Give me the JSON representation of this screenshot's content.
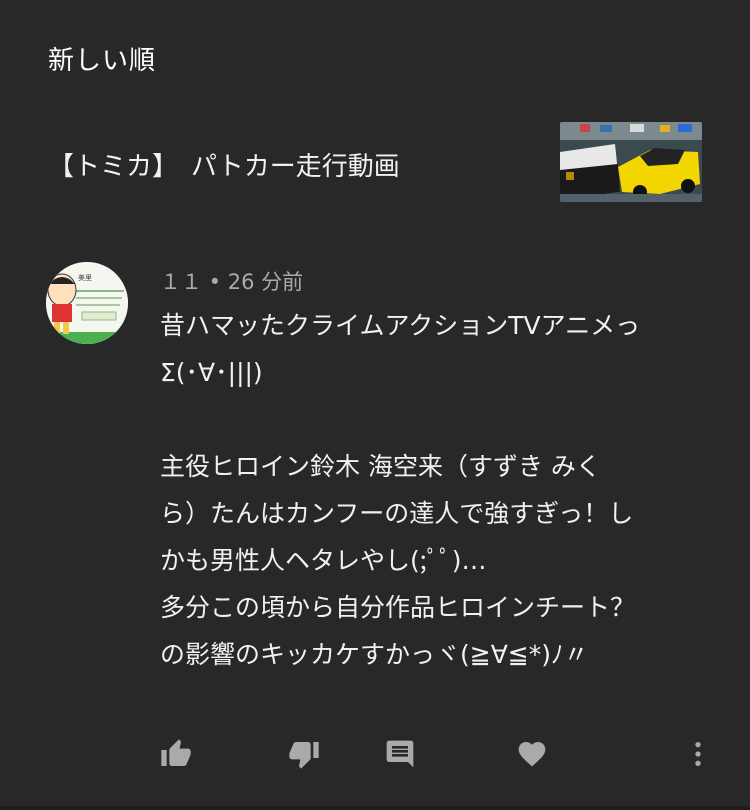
{
  "header": {
    "sort_label": "新しい順"
  },
  "video": {
    "title": "【トミカ】　パトカー走行動画"
  },
  "comment": {
    "meta": "１１ • 26 分前",
    "lines": [
      "昔ハマッたクライムアクションTVアニメっ",
      "Σ(･∀･|||)",
      "",
      "主役ヒロイン鈴木 海空来（すずき みく",
      "ら）たんはカンフーの達人で強すぎっ！し",
      "かも男性人ヘタレやし(;ﾟﾟ)…",
      "多分この頃から自分作品ヒロインチート？",
      "の影響のキッカケすかっヾ(≧∀≦*)ﾉ〃"
    ]
  },
  "actions": {
    "icons": [
      "like-icon",
      "dislike-icon",
      "reply-icon",
      "heart-icon",
      "more-icon"
    ]
  },
  "colors": {
    "background": "#282828",
    "text": "#f1f1f1",
    "meta": "#aaaaaa",
    "icon": "#aaaaaa"
  }
}
